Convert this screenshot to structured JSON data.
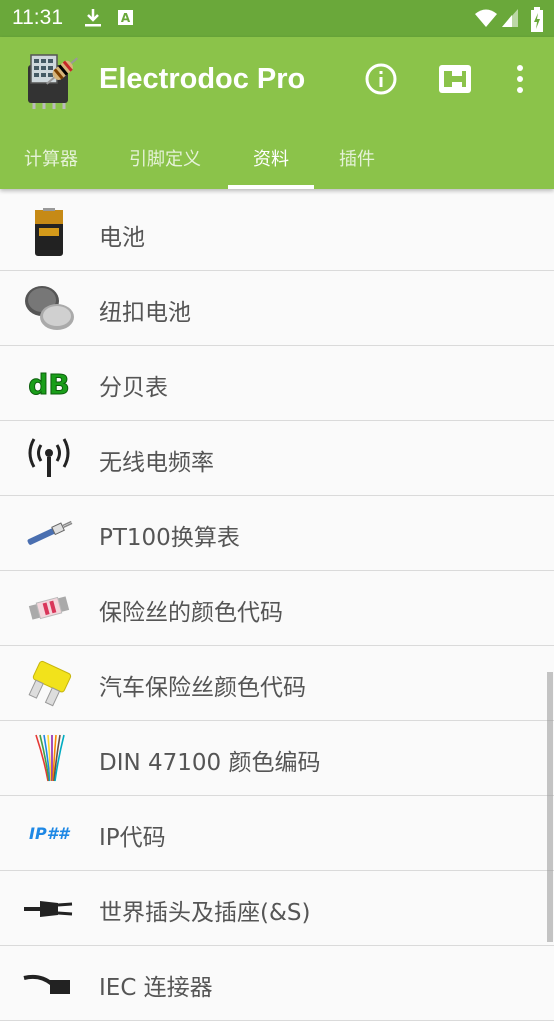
{
  "status": {
    "time": "11:31"
  },
  "app": {
    "title": "Electrodoc Pro"
  },
  "tabs": [
    {
      "label": "计算器"
    },
    {
      "label": "引脚定义"
    },
    {
      "label": "资料"
    },
    {
      "label": "插件"
    }
  ],
  "list": [
    {
      "label": "电池",
      "icon": "battery-icon"
    },
    {
      "label": "纽扣电池",
      "icon": "coin-cell-icon"
    },
    {
      "label": "分贝表",
      "icon": "db-icon"
    },
    {
      "label": "无线电频率",
      "icon": "antenna-icon"
    },
    {
      "label": "PT100换算表",
      "icon": "pt100-sensor-icon"
    },
    {
      "label": "保险丝的颜色代码",
      "icon": "fuse-icon"
    },
    {
      "label": "汽车保险丝颜色代码",
      "icon": "car-fuse-icon"
    },
    {
      "label": "DIN 47100 颜色编码",
      "icon": "wires-icon"
    },
    {
      "label": "IP代码",
      "icon": "ip-code-icon"
    },
    {
      "label": "世界插头及插座(&S)",
      "icon": "plug-icon"
    },
    {
      "label": "IEC 连接器",
      "icon": "iec-connector-icon"
    }
  ],
  "colors": {
    "statusbar": "#6aa83a",
    "toolbar": "#8bc34a"
  }
}
